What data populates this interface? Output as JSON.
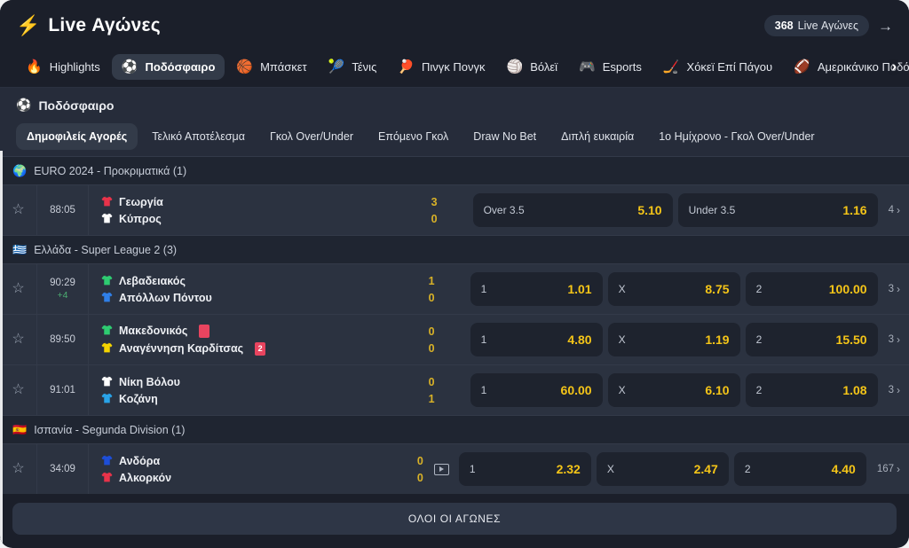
{
  "header": {
    "bolt_icon": "bolt-icon",
    "title": "Live Αγώνες",
    "live_count": "368",
    "live_count_label": "Live Αγώνες",
    "arrow_icon": "arrow-right-icon",
    "sports": [
      {
        "label": "Highlights",
        "icon": "fire-icon",
        "glyph": "🔥",
        "active": false
      },
      {
        "label": "Ποδόσφαιρο",
        "icon": "soccer-ball-icon",
        "glyph": "⚽",
        "active": true
      },
      {
        "label": "Μπάσκετ",
        "icon": "basketball-icon",
        "glyph": "🏀",
        "active": false
      },
      {
        "label": "Τένις",
        "icon": "tennis-ball-icon",
        "glyph": "🎾",
        "active": false
      },
      {
        "label": "Πινγκ Πονγκ",
        "icon": "ping-pong-icon",
        "glyph": "🏓",
        "active": false
      },
      {
        "label": "Βόλεϊ",
        "icon": "volleyball-icon",
        "glyph": "🏐",
        "active": false
      },
      {
        "label": "Esports",
        "icon": "gamepad-icon",
        "glyph": "🎮",
        "active": false
      },
      {
        "label": "Χόκεϊ Επί Πάγου",
        "icon": "ice-hockey-icon",
        "glyph": "🏒",
        "active": false
      },
      {
        "label": "Αμερικάνικο Ποδόσφαιρο",
        "icon": "american-football-icon",
        "glyph": "🏈",
        "active": false
      }
    ],
    "sports_scroll_chevron": "chevron-right-icon"
  },
  "sportbar": {
    "icon": "soccer-ball-icon",
    "glyph": "⚽",
    "title": "Ποδόσφαιρο",
    "markets": [
      {
        "label": "Δημοφιλείς Αγορές",
        "active": true
      },
      {
        "label": "Τελικό Αποτέλεσμα",
        "active": false
      },
      {
        "label": "Γκολ Over/Under",
        "active": false
      },
      {
        "label": "Επόμενο Γκολ",
        "active": false
      },
      {
        "label": "Draw No Bet",
        "active": false
      },
      {
        "label": "Διπλή ευκαιρία",
        "active": false
      },
      {
        "label": "1ο Ημίχρονο - Γκολ Over/Under",
        "active": false
      }
    ]
  },
  "leagues": [
    {
      "flag_icon": "globe-icon",
      "flag_glyph": "🌍",
      "name": "EURO 2024 - Προκριματικά (1)",
      "matches": [
        {
          "star_icon": "star-outline-icon",
          "time": "88:05",
          "extra_time": "",
          "home": {
            "name": "Γεωργία",
            "shirt_icon": "shirt-icon",
            "shirt_color": "#e8334a",
            "score": "3",
            "card": ""
          },
          "away": {
            "name": "Κύπρος",
            "shirt_icon": "shirt-icon",
            "shirt_color": "#ffffff",
            "score": "0",
            "card": ""
          },
          "has_video": false,
          "odds_width": "w2",
          "odds": [
            {
              "label": "Over 3.5",
              "value": "5.10"
            },
            {
              "label": "Under 3.5",
              "value": "1.16"
            }
          ],
          "more_count": "4"
        }
      ]
    },
    {
      "flag_icon": "greece-flag-icon",
      "flag_glyph": "🇬🇷",
      "name": "Ελλάδα - Super League 2 (3)",
      "matches": [
        {
          "star_icon": "star-outline-icon",
          "time": "90:29",
          "extra_time": "+4",
          "home": {
            "name": "Λεβαδειακός",
            "shirt_icon": "shirt-icon",
            "shirt_color": "#2ecc71",
            "score": "1",
            "card": ""
          },
          "away": {
            "name": "Απόλλων Πόντου",
            "shirt_icon": "shirt-icon",
            "shirt_color": "#2f7fe8",
            "score": "0",
            "card": ""
          },
          "has_video": false,
          "odds_width": "w3",
          "odds": [
            {
              "label": "1",
              "value": "1.01"
            },
            {
              "label": "X",
              "value": "8.75"
            },
            {
              "label": "2",
              "value": "100.00"
            }
          ],
          "more_count": "3"
        },
        {
          "star_icon": "star-outline-icon",
          "time": "89:50",
          "extra_time": "",
          "home": {
            "name": "Μακεδονικός",
            "shirt_icon": "shirt-icon",
            "shirt_color": "#2ecc71",
            "score": "0",
            "card": " "
          },
          "away": {
            "name": "Αναγέννηση Καρδίτσας",
            "shirt_icon": "shirt-icon",
            "shirt_color": "#f5d400",
            "score": "0",
            "card": "2"
          },
          "has_video": false,
          "odds_width": "w3",
          "odds": [
            {
              "label": "1",
              "value": "4.80"
            },
            {
              "label": "X",
              "value": "1.19"
            },
            {
              "label": "2",
              "value": "15.50"
            }
          ],
          "more_count": "3"
        },
        {
          "star_icon": "star-outline-icon",
          "time": "91:01",
          "extra_time": "",
          "home": {
            "name": "Νίκη Βόλου",
            "shirt_icon": "shirt-icon",
            "shirt_color": "#ffffff",
            "score": "0",
            "card": ""
          },
          "away": {
            "name": "Κοζάνη",
            "shirt_icon": "shirt-icon",
            "shirt_color": "#29a3e8",
            "score": "1",
            "card": ""
          },
          "has_video": false,
          "odds_width": "w3",
          "odds": [
            {
              "label": "1",
              "value": "60.00"
            },
            {
              "label": "X",
              "value": "6.10"
            },
            {
              "label": "2",
              "value": "1.08"
            }
          ],
          "more_count": "3"
        }
      ]
    },
    {
      "flag_icon": "spain-flag-icon",
      "flag_glyph": "🇪🇸",
      "name": "Ισπανία - Segunda Division (1)",
      "matches": [
        {
          "star_icon": "star-outline-icon",
          "time": "34:09",
          "extra_time": "",
          "home": {
            "name": "Ανδόρα",
            "shirt_icon": "shirt-icon",
            "shirt_color": "#1d4ed8",
            "score": "0",
            "card": ""
          },
          "away": {
            "name": "Αλκορκόν",
            "shirt_icon": "shirt-icon",
            "shirt_color": "#e8334a",
            "score": "0",
            "card": ""
          },
          "has_video": true,
          "video_icon": "video-play-icon",
          "odds_width": "w3",
          "odds": [
            {
              "label": "1",
              "value": "2.32"
            },
            {
              "label": "X",
              "value": "2.47"
            },
            {
              "label": "2",
              "value": "4.40"
            }
          ],
          "more_count": "167"
        }
      ]
    }
  ],
  "footer": {
    "all_matches_label": "ΟΛΟΙ ΟΙ ΑΓΩΝΕΣ"
  },
  "colors": {
    "accent_yellow": "#f5c518",
    "score_yellow": "#d9b227",
    "panel": "#2b3240",
    "page_bg": "#1b1f2a",
    "card_red": "#e8445f",
    "extra_time_green": "#4caf72"
  }
}
